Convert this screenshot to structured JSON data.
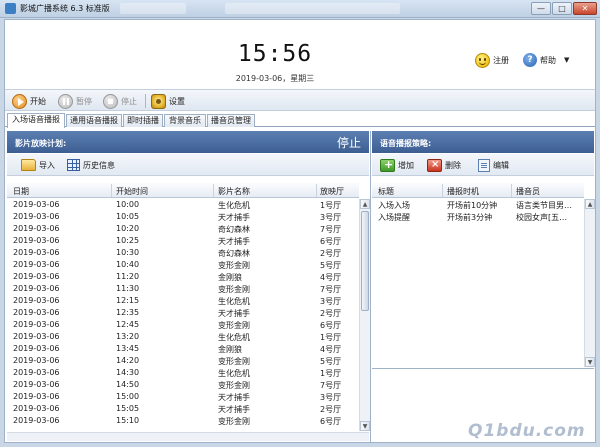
{
  "window": {
    "title": "影城广播系统 6.3 标准版",
    "minimize": "—",
    "maximize": "□",
    "close": "✕"
  },
  "header": {
    "time": "15:56",
    "date": "2019-03-06，星期三",
    "register_label": "注册",
    "help_label": "帮助",
    "menu_caret": "▼"
  },
  "toolbar": {
    "start": "开始",
    "pause": "暂停",
    "stop": "停止",
    "settings": "设置"
  },
  "tabs": [
    {
      "label": "入场语音播报"
    },
    {
      "label": "通用语音播报"
    },
    {
      "label": "即时插播"
    },
    {
      "label": "背景音乐"
    },
    {
      "label": "播音员管理"
    }
  ],
  "left_panel": {
    "title": "影片放映计划:",
    "status": "停止",
    "import_label": "导入",
    "history_label": "历史信息",
    "columns": [
      "日期",
      "开始时间",
      "影片名称",
      "放映厅"
    ],
    "rows": [
      [
        "2019-03-06",
        "10:00",
        "生化危机",
        "1号厅"
      ],
      [
        "2019-03-06",
        "10:05",
        "天才捕手",
        "3号厅"
      ],
      [
        "2019-03-06",
        "10:20",
        "奇幻森林",
        "7号厅"
      ],
      [
        "2019-03-06",
        "10:25",
        "天才捕手",
        "6号厅"
      ],
      [
        "2019-03-06",
        "10:30",
        "奇幻森林",
        "2号厅"
      ],
      [
        "2019-03-06",
        "10:40",
        "变形金刚",
        "5号厅"
      ],
      [
        "2019-03-06",
        "11:20",
        "金刚狼",
        "4号厅"
      ],
      [
        "2019-03-06",
        "11:30",
        "变形金刚",
        "7号厅"
      ],
      [
        "2019-03-06",
        "12:15",
        "生化危机",
        "3号厅"
      ],
      [
        "2019-03-06",
        "12:35",
        "天才捕手",
        "2号厅"
      ],
      [
        "2019-03-06",
        "12:45",
        "变形金刚",
        "6号厅"
      ],
      [
        "2019-03-06",
        "13:20",
        "生化危机",
        "1号厅"
      ],
      [
        "2019-03-06",
        "13:45",
        "金刚狼",
        "4号厅"
      ],
      [
        "2019-03-06",
        "14:20",
        "变形金刚",
        "5号厅"
      ],
      [
        "2019-03-06",
        "14:30",
        "生化危机",
        "1号厅"
      ],
      [
        "2019-03-06",
        "14:50",
        "变形金刚",
        "7号厅"
      ],
      [
        "2019-03-06",
        "15:00",
        "天才捕手",
        "3号厅"
      ],
      [
        "2019-03-06",
        "15:05",
        "天才捕手",
        "2号厅"
      ],
      [
        "2019-03-06",
        "15:10",
        "变形金刚",
        "6号厅"
      ]
    ]
  },
  "right_panel": {
    "title": "语音播报策略:",
    "add_label": "增加",
    "delete_label": "删除",
    "edit_label": "编辑",
    "columns": [
      "标题",
      "播报时机",
      "播音员"
    ],
    "rows": [
      [
        "入场入场",
        "开场前10分钟",
        "语言类节目男…"
      ],
      [
        "入场提醒",
        "开场前3分钟",
        "校园女声[五…"
      ]
    ]
  },
  "watermark": "Q1bdu.com"
}
